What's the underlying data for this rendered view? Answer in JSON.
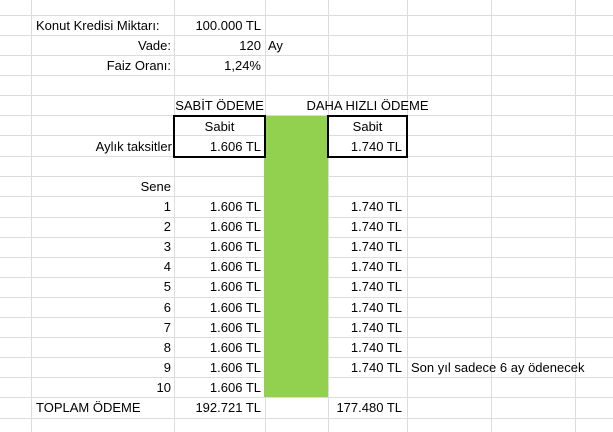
{
  "labels": {
    "loan_amount": "Konut Kredisi Miktarı:",
    "term": "Vade:",
    "rate": "Faiz Oranı:",
    "monthly": "Aylık taksitler",
    "year": "Sene",
    "total": "TOPLAM ÖDEME",
    "term_unit": "Ay"
  },
  "values": {
    "loan_amount": "100.000 TL",
    "term": "120",
    "rate": "1,24%"
  },
  "headers": {
    "fixed": "SABİT ÖDEME",
    "faster": "DAHA HIZLI ÖDEME",
    "fixed_sub": "Sabit",
    "faster_sub": "Sabit"
  },
  "monthly": {
    "fixed": "1.606 TL",
    "faster": "1.740 TL"
  },
  "years": [
    {
      "n": "1",
      "fixed": "1.606 TL",
      "faster": "1.740 TL",
      "note": ""
    },
    {
      "n": "2",
      "fixed": "1.606 TL",
      "faster": "1.740 TL",
      "note": ""
    },
    {
      "n": "3",
      "fixed": "1.606 TL",
      "faster": "1.740 TL",
      "note": ""
    },
    {
      "n": "4",
      "fixed": "1.606 TL",
      "faster": "1.740 TL",
      "note": ""
    },
    {
      "n": "5",
      "fixed": "1.606 TL",
      "faster": "1.740 TL",
      "note": ""
    },
    {
      "n": "6",
      "fixed": "1.606 TL",
      "faster": "1.740 TL",
      "note": ""
    },
    {
      "n": "7",
      "fixed": "1.606 TL",
      "faster": "1.740 TL",
      "note": ""
    },
    {
      "n": "8",
      "fixed": "1.606 TL",
      "faster": "1.740 TL",
      "note": ""
    },
    {
      "n": "9",
      "fixed": "1.606 TL",
      "faster": "1.740 TL",
      "note": "Son yıl sadece 6 ay ödenecek"
    },
    {
      "n": "10",
      "fixed": "1.606 TL",
      "faster": "",
      "note": ""
    }
  ],
  "totals": {
    "fixed": "192.721 TL",
    "faster": "177.480 TL"
  },
  "colors": {
    "highlight": "#92d050",
    "gridline": "#dadcdd"
  }
}
